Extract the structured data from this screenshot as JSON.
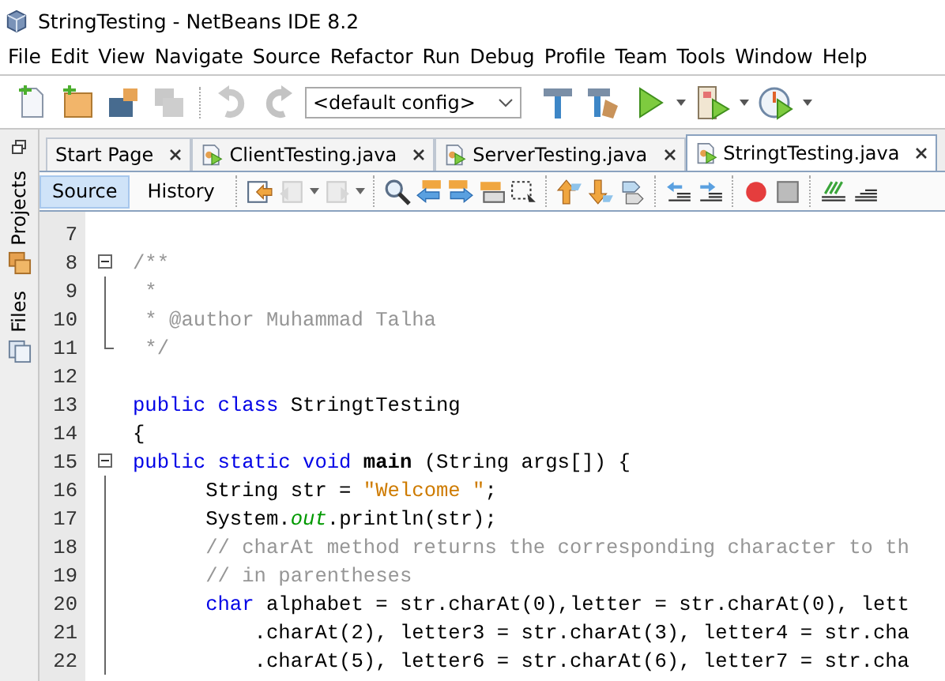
{
  "window": {
    "title": "StringTesting - NetBeans IDE 8.2"
  },
  "menu": [
    "File",
    "Edit",
    "View",
    "Navigate",
    "Source",
    "Refactor",
    "Run",
    "Debug",
    "Profile",
    "Team",
    "Tools",
    "Window",
    "Help"
  ],
  "main_toolbar": {
    "save_all": {
      "disabled": true
    },
    "undo": {
      "disabled": true
    },
    "redo": {
      "disabled": true
    },
    "config": "<default config>"
  },
  "side_panel": {
    "tabs": [
      "Projects",
      "Files"
    ]
  },
  "editor_tabs": [
    {
      "label": "Start Page",
      "kind": "page",
      "selected": false
    },
    {
      "label": "ClientTesting.java",
      "kind": "java",
      "selected": false
    },
    {
      "label": "ServerTesting.java",
      "kind": "java",
      "selected": false
    },
    {
      "label": "StringtTesting.java",
      "kind": "java",
      "selected": true
    }
  ],
  "view_toggle": [
    {
      "label": "Source",
      "selected": true
    },
    {
      "label": "History",
      "selected": false
    }
  ],
  "editor_toolbar": {
    "back": {
      "disabled": true
    },
    "forward": {
      "disabled": true
    }
  },
  "code_lines": [
    {
      "number": "7",
      "kind": "plain"
    },
    {
      "number": "8",
      "kind": "fold-start",
      "tokens": [
        {
          "kind": "comment",
          "text": "/**"
        }
      ]
    },
    {
      "number": "9",
      "kind": "fold-line",
      "tokens": [
        {
          "kind": "comment",
          "text": " *"
        }
      ]
    },
    {
      "number": "10",
      "kind": "fold-line",
      "tokens": [
        {
          "kind": "comment",
          "text": " * @author Muhammad Talha"
        }
      ]
    },
    {
      "number": "11",
      "kind": "fold-end",
      "tokens": [
        {
          "kind": "comment",
          "text": " */"
        }
      ]
    },
    {
      "number": "12",
      "kind": "plain"
    },
    {
      "number": "13",
      "kind": "plain",
      "tokens": [
        {
          "kind": "keyword",
          "text": "public class"
        },
        {
          "kind": "plain",
          "text": " StringtTesting"
        }
      ]
    },
    {
      "number": "14",
      "kind": "plain",
      "tokens": [
        {
          "kind": "plain",
          "text": "{"
        }
      ]
    },
    {
      "number": "15",
      "kind": "fold-start",
      "tokens": [
        {
          "kind": "keyword",
          "text": "public static void"
        },
        {
          "kind": "method",
          "text": " main"
        },
        {
          "kind": "plain",
          "text": " (String args[]) {"
        }
      ]
    },
    {
      "number": "16",
      "kind": "fold-line",
      "tokens": [
        {
          "kind": "plain",
          "text": "      String str = "
        },
        {
          "kind": "string",
          "text": "\"Welcome \""
        },
        {
          "kind": "plain",
          "text": ";"
        }
      ]
    },
    {
      "number": "17",
      "kind": "fold-line",
      "tokens": [
        {
          "kind": "plain",
          "text": "      System."
        },
        {
          "kind": "field",
          "text": "out"
        },
        {
          "kind": "plain",
          "text": ".println(str);"
        }
      ]
    },
    {
      "number": "18",
      "kind": "fold-line",
      "tokens": [
        {
          "kind": "comment",
          "text": "      // charAt method returns the corresponding character to th"
        }
      ]
    },
    {
      "number": "19",
      "kind": "fold-line",
      "tokens": [
        {
          "kind": "comment",
          "text": "      // in parentheses"
        }
      ]
    },
    {
      "number": "20",
      "kind": "fold-line",
      "tokens": [
        {
          "kind": "keyword",
          "text": "      char"
        },
        {
          "kind": "plain",
          "text": " alphabet = str.charAt(0),letter = str.charAt(0), lett"
        }
      ]
    },
    {
      "number": "21",
      "kind": "fold-line",
      "tokens": [
        {
          "kind": "plain",
          "text": "          .charAt(2), letter3 = str.charAt(3), letter4 = str.cha"
        }
      ]
    },
    {
      "number": "22",
      "kind": "fold-line",
      "tokens": [
        {
          "kind": "plain",
          "text": "          .charAt(5), letter6 = str.charAt(6), letter7 = str.cha"
        }
      ]
    }
  ]
}
